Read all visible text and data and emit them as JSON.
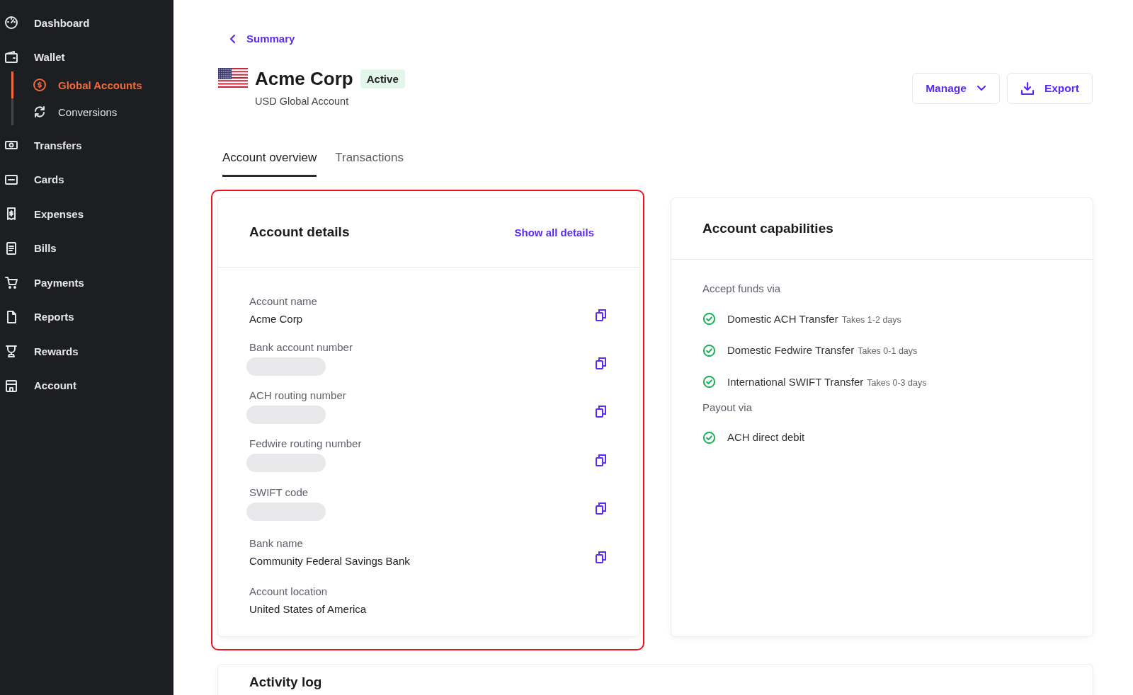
{
  "sidebar": {
    "items": [
      {
        "label": "Dashboard",
        "selected": false
      },
      {
        "label": "Wallet",
        "selected": false,
        "children": [
          {
            "label": "Global Accounts",
            "selected": true
          },
          {
            "label": "Conversions",
            "selected": false
          }
        ]
      },
      {
        "label": "Transfers",
        "selected": false
      },
      {
        "label": "Cards",
        "selected": false
      },
      {
        "label": "Expenses",
        "selected": false
      },
      {
        "label": "Bills",
        "selected": false
      },
      {
        "label": "Payments",
        "selected": false
      },
      {
        "label": "Reports",
        "selected": false
      },
      {
        "label": "Rewards",
        "selected": false
      },
      {
        "label": "Account",
        "selected": false
      }
    ]
  },
  "back_link": "Summary",
  "header": {
    "title": "Acme Corp",
    "status": "Active",
    "subtitle": "USD Global Account"
  },
  "actions": [
    {
      "label": "Manage",
      "kind": "dropdown"
    },
    {
      "label": "Export",
      "kind": "export"
    }
  ],
  "tabs": [
    {
      "label": "Account overview",
      "selected": true
    },
    {
      "label": "Transactions",
      "selected": false
    }
  ],
  "account_details": {
    "title": "Account details",
    "link": "Show all details",
    "highlighted": true,
    "fields": [
      {
        "label": "Account name",
        "value": "Acme Corp",
        "redacted": false,
        "copyable": true
      },
      {
        "label": "Bank account number",
        "redacted": true,
        "copyable": true
      },
      {
        "label": "ACH routing number",
        "redacted": true,
        "copyable": true
      },
      {
        "label": "Fedwire routing number",
        "redacted": true,
        "copyable": true
      },
      {
        "label": "SWIFT code",
        "redacted": true,
        "copyable": true
      },
      {
        "label": "Bank name",
        "value": "Community Federal Savings Bank",
        "redacted": false,
        "copyable": true
      },
      {
        "label": "Account location",
        "value": "United States of America",
        "redacted": false,
        "copyable": false
      }
    ]
  },
  "account_capabilities": {
    "title": "Account capabilities",
    "sections": [
      {
        "heading": "Accept funds via",
        "items": [
          {
            "name": "Domestic ACH Transfer",
            "note": "Takes 1-2 days",
            "enabled": true
          },
          {
            "name": "Domestic Fedwire Transfer",
            "note": "Takes 0-1 days",
            "enabled": true
          },
          {
            "name": "International SWIFT Transfer",
            "note": "Takes 0-3 days",
            "enabled": true
          }
        ]
      },
      {
        "heading": "Payout via",
        "items": [
          {
            "name": "ACH direct debit",
            "enabled": true
          }
        ]
      }
    ]
  },
  "activity_log": {
    "title": "Activity log"
  }
}
